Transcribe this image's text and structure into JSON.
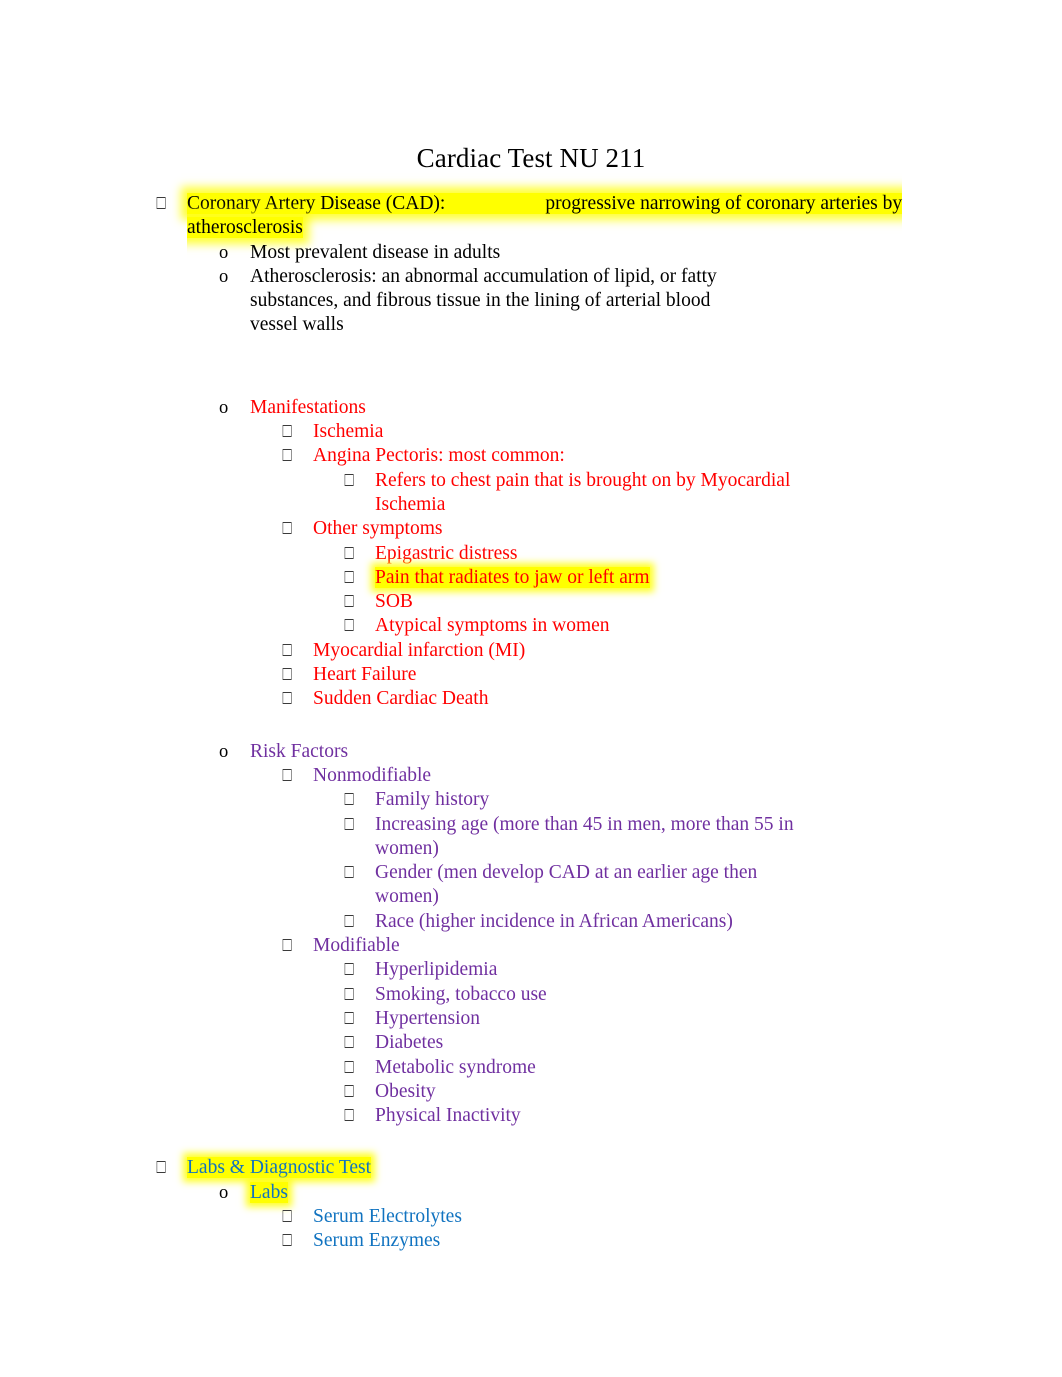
{
  "document": {
    "title": "Cardiac Test NU 211",
    "colors": {
      "black": "#000000",
      "red": "#ff0000",
      "purple": "#7030a0",
      "blue": "#1173c0",
      "highlight": "#ffff00"
    },
    "bullet_glyphs": {
      "box": "⎕",
      "circle": "o"
    }
  },
  "outline": {
    "cad": {
      "heading_part1": "Coronary Artery Disease (CAD):",
      "heading_part2": "progressive narrowing of coronary arteries by atherosclerosis",
      "items": [
        "Most prevalent disease in adults",
        "Atherosclerosis: an abnormal accumulation of lipid, or fatty substances, and fibrous tissue in the lining of arterial blood vessel walls"
      ]
    },
    "manifestations": {
      "heading": "Manifestations",
      "ischemia": "Ischemia",
      "angina": "Angina Pectoris: most common:",
      "angina_detail": "Refers to chest pain that is brought on by Myocardial Ischemia",
      "other_symptoms": "Other symptoms",
      "other_symptoms_items": [
        "Epigastric distress",
        "Pain that radiates to jaw or left arm",
        "SOB",
        "Atypical symptoms in women"
      ],
      "mi": "Myocardial infarction (MI)",
      "heart_failure": "Heart Failure",
      "sudden_cardiac_death": "Sudden Cardiac Death"
    },
    "risk_factors": {
      "heading": "Risk Factors",
      "nonmodifiable": {
        "heading": "Nonmodifiable",
        "items": [
          "Family history",
          "Increasing age (more than 45 in men, more than 55 in women)",
          "Gender (men develop CAD at an earlier age then women)",
          "Race (higher incidence in African Americans)"
        ]
      },
      "modifiable": {
        "heading": "Modifiable",
        "items": [
          "Hyperlipidemia",
          "Smoking, tobacco use",
          "Hypertension",
          "Diabetes",
          "Metabolic syndrome",
          "Obesity",
          "Physical Inactivity"
        ]
      }
    },
    "labs": {
      "heading": "Labs & Diagnostic Test",
      "subheading": "Labs",
      "items": [
        "Serum Electrolytes",
        "Serum Enzymes"
      ]
    }
  }
}
